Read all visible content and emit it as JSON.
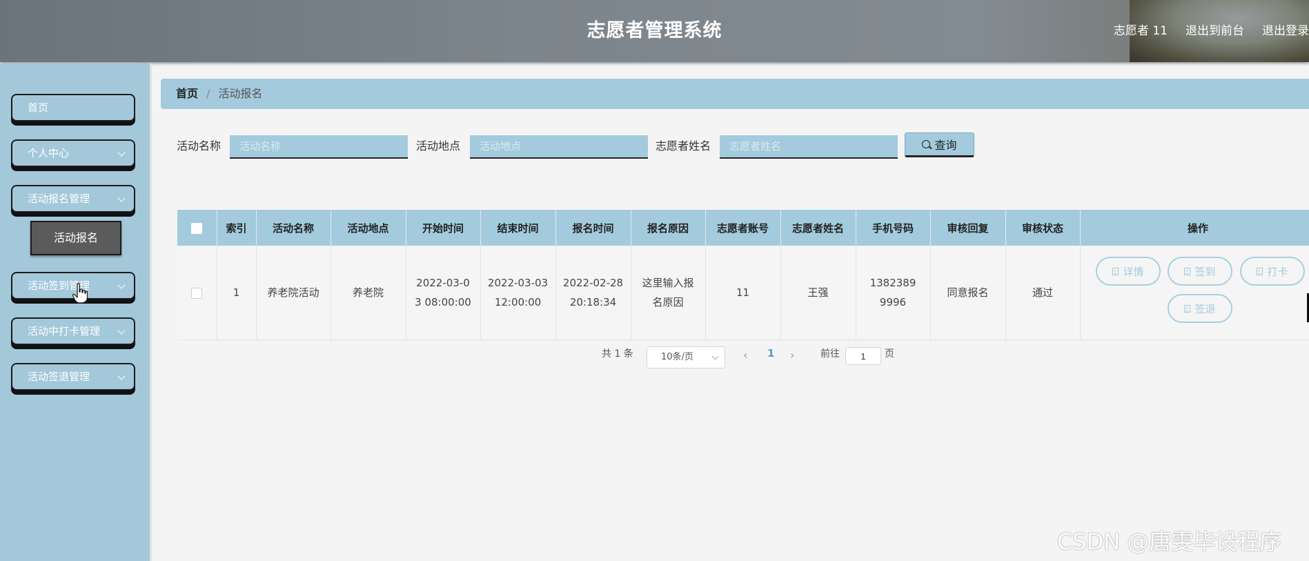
{
  "header": {
    "title": "志愿者管理系统",
    "username": "志愿者 11",
    "to_front": "退出到前台",
    "logout": "退出登录"
  },
  "sidebar": {
    "items": [
      {
        "label": "首页"
      },
      {
        "label": "个人中心"
      },
      {
        "label": "活动报名管理"
      },
      {
        "label": "活动签到管理"
      },
      {
        "label": "活动中打卡管理"
      },
      {
        "label": "活动签退管理"
      }
    ],
    "submenu_label": "活动报名"
  },
  "breadcrumb": {
    "home": "首页",
    "separator": "/",
    "current": "活动报名"
  },
  "search": {
    "activity_name_label": "活动名称",
    "activity_name_placeholder": "活动名称",
    "location_label": "活动地点",
    "location_placeholder": "活动地点",
    "volunteer_name_label": "志愿者姓名",
    "volunteer_name_placeholder": "志愿者姓名",
    "query_button": "查询"
  },
  "table": {
    "headers": [
      "索引",
      "活动名称",
      "活动地点",
      "开始时间",
      "结束时间",
      "报名时间",
      "报名原因",
      "志愿者账号",
      "志愿者姓名",
      "手机号码",
      "审核回复",
      "审核状态",
      "操作"
    ],
    "rows": [
      {
        "index": "1",
        "activity_name": "养老院活动",
        "location": "养老院",
        "start_time": "2022-03-03 08:00:00",
        "end_time": "2022-03-03 12:00:00",
        "signup_time": "2022-02-28 20:18:34",
        "reason": "这里输入报名原因",
        "account": "11",
        "name": "王强",
        "phone": "13823899996",
        "review_reply": "同意报名",
        "review_status": "通过",
        "actions": {
          "detail": "详情",
          "sign_in": "签到",
          "punch": "打卡",
          "sign_out": "签退"
        }
      }
    ]
  },
  "pagination": {
    "total_text": "共 1 条",
    "page_size": "10条/页",
    "current_page": "1",
    "goto_label": "前往",
    "goto_value": "1",
    "page_unit": "页"
  },
  "watermark": "CSDN @唐雯毕设程序"
}
